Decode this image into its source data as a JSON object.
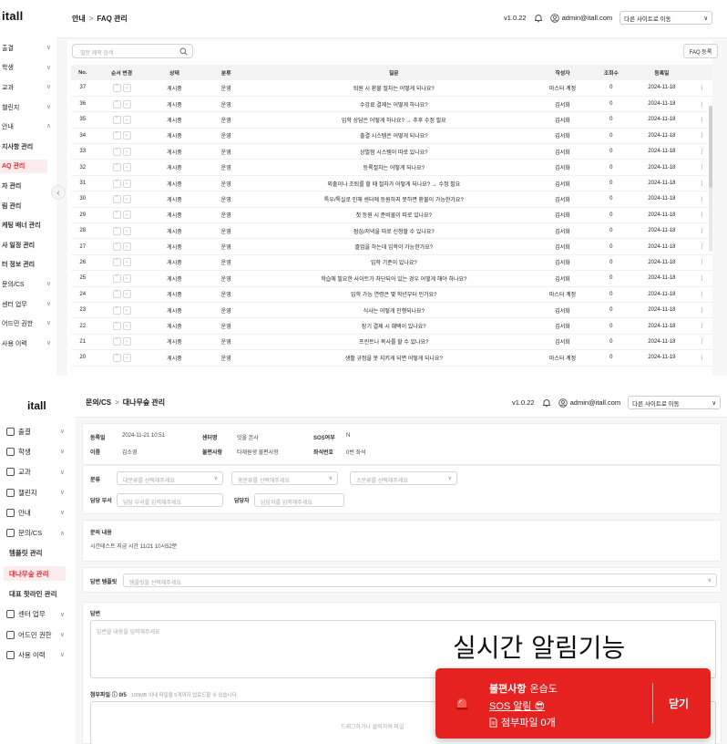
{
  "top": {
    "logo": "itall",
    "nav": [
      {
        "label": "출결",
        "kind": "group",
        "chev": "∨"
      },
      {
        "label": "학생",
        "kind": "group",
        "chev": "∨"
      },
      {
        "label": "교과",
        "kind": "group",
        "chev": "∨"
      },
      {
        "label": "챌린지",
        "kind": "group",
        "chev": "∨"
      },
      {
        "label": "안내",
        "kind": "group",
        "chev": "∧"
      },
      {
        "label": "지사항 관리",
        "kind": "sub"
      },
      {
        "label": "AQ 관리",
        "kind": "sub active"
      },
      {
        "label": "자 관리",
        "kind": "sub"
      },
      {
        "label": "림 관리",
        "kind": "sub"
      },
      {
        "label": "케팅 배너 관리",
        "kind": "sub"
      },
      {
        "label": "사 일정 관리",
        "kind": "sub"
      },
      {
        "label": "터 정보 관리",
        "kind": "sub"
      },
      {
        "label": "문의/CS",
        "kind": "group",
        "chev": "∨"
      },
      {
        "label": "센터 업무",
        "kind": "group",
        "chev": "∨"
      },
      {
        "label": "어드민 권한",
        "kind": "group",
        "chev": "∨"
      },
      {
        "label": "사용 이력",
        "kind": "group",
        "chev": "∨"
      }
    ],
    "breadcrumb": {
      "parent": "안내",
      "sep": ">",
      "current": "FAQ 관리"
    },
    "version": "v1.0.22",
    "admin_email": "admin@itall.com",
    "site_select": "다른 사이트로 이동",
    "search_placeholder": "질문 제목 검색",
    "register_button": "FAQ 등록",
    "columns": [
      "No.",
      "순서 변경",
      "상태",
      "분류",
      "질문",
      "작성자",
      "조회수",
      "등록일"
    ],
    "rows": [
      [
        "37",
        "게시중",
        "운영",
        "퇴원 시 환불 절차는 어떻게 되나요?",
        "마스터 계정",
        "0",
        "2024-11-18"
      ],
      [
        "36",
        "게시중",
        "운영",
        "수강료 결제는 어떻게 하나요?",
        "김서화",
        "0",
        "2024-11-18"
      ],
      [
        "35",
        "게시중",
        "운영",
        "입학 상담은 어떻게 하나요? → 추후 수정 필요",
        "김서화",
        "0",
        "2024-11-18"
      ],
      [
        "34",
        "게시중",
        "운영",
        "출결 시스템은 어떻게 되나요?",
        "김서화",
        "0",
        "2024-11-18"
      ],
      [
        "33",
        "게시중",
        "운영",
        "상벌점 시스템이 따로 있나요?",
        "김서화",
        "0",
        "2024-11-18"
      ],
      [
        "32",
        "게시중",
        "운영",
        "등록절차는 어떻게 되나요?",
        "김서화",
        "0",
        "2024-11-18"
      ],
      [
        "31",
        "게시중",
        "운영",
        "외출이나 조퇴를 할 때 절차가 어떻게 되나요? → 수정 필요",
        "김서화",
        "0",
        "2024-11-18"
      ],
      [
        "30",
        "게시중",
        "운영",
        "특우/특실로 인해 센터에 등원하지 못하면 환불이 가능한가요?",
        "김서화",
        "0",
        "2024-11-18"
      ],
      [
        "29",
        "게시중",
        "운영",
        "첫 등원 시 준비물이 따로 있나요?",
        "김서화",
        "0",
        "2024-11-18"
      ],
      [
        "28",
        "게시중",
        "운영",
        "점심/저녁을 따로 신청할 수 있나요?",
        "김서화",
        "0",
        "2024-11-18"
      ],
      [
        "27",
        "게시중",
        "운영",
        "졸업을 하는데 입학이 가능한가요?",
        "김서화",
        "0",
        "2024-11-18"
      ],
      [
        "26",
        "게시중",
        "운영",
        "입학 기준이 있나요?",
        "김서화",
        "0",
        "2024-11-18"
      ],
      [
        "25",
        "게시중",
        "운영",
        "학습에 필요한 사이트가 차단되어 있는 경우 어떻게 해야 하나요?",
        "김서화",
        "0",
        "2024-11-18"
      ],
      [
        "24",
        "게시중",
        "운영",
        "입학 가능 연령은 몇 학년부터 인가요?",
        "마스터 계정",
        "0",
        "2024-11-18"
      ],
      [
        "23",
        "게시중",
        "운영",
        "식사는 어떻게 진행되나요?",
        "김서화",
        "0",
        "2024-11-18"
      ],
      [
        "22",
        "게시중",
        "운영",
        "장기 결제 시 혜택이 있나요?",
        "김서화",
        "0",
        "2024-11-18"
      ],
      [
        "21",
        "게시중",
        "운영",
        "프린트나 복사를 할 수 있나요?",
        "김서화",
        "0",
        "2024-11-18"
      ],
      [
        "20",
        "게시중",
        "운영",
        "생활 규정을 못 지키게 되면 어떻게 되나요?",
        "마스터 계정",
        "0",
        "2024-11-19"
      ]
    ]
  },
  "bottom": {
    "logo": "itall",
    "nav": [
      {
        "label": "출결",
        "kind": "group",
        "chev": "∨"
      },
      {
        "label": "학생",
        "kind": "group",
        "chev": "∨"
      },
      {
        "label": "교과",
        "kind": "group",
        "chev": "∨"
      },
      {
        "label": "챌린지",
        "kind": "group",
        "chev": "∨"
      },
      {
        "label": "안내",
        "kind": "group",
        "chev": "∨"
      },
      {
        "label": "문의/CS",
        "kind": "group",
        "chev": "∧"
      },
      {
        "label": "템플릿 관리",
        "kind": "sub"
      },
      {
        "label": "대나무숲 관리",
        "kind": "sub active"
      },
      {
        "label": "대표 핫라인 관리",
        "kind": "sub"
      },
      {
        "label": "센터 업무",
        "kind": "group",
        "chev": "∨"
      },
      {
        "label": "어드민 권한",
        "kind": "group",
        "chev": "∨"
      },
      {
        "label": "사용 이력",
        "kind": "group",
        "chev": "∨"
      }
    ],
    "breadcrumb": {
      "parent": "문의/CS",
      "sep": ">",
      "current": "대나무숲 관리"
    },
    "version": "v1.0.22",
    "admin_email": "admin@itall.com",
    "site_select": "다른 사이트로 이동",
    "info": {
      "reg_label": "등록일",
      "reg_value": "2024-11-21 10:51",
      "center_label": "센터명",
      "center_value": "잇올 본사",
      "sos_label": "SOS여부",
      "sos_value": "N",
      "name_label": "이름",
      "name_value": "김소영",
      "complaint_label": "불편사항",
      "complaint_value": "타재원생 불편사항",
      "seat_label": "좌석번호",
      "seat_value": "0번 좌석"
    },
    "classify": {
      "label": "분류",
      "major": "대분류를 선택해주세요",
      "middle": "중분류를 선택해주세요",
      "minor": "소분류를 선택해주세요",
      "dept_label": "담당 부서",
      "dept_placeholder": "담당 부서를 입력해주세요",
      "person_label": "담당자",
      "person_placeholder": "담당자를 입력해주세요"
    },
    "inquiry": {
      "label": "문의 내용",
      "text": "시간테스트 지금 시간 11/21 10시52분"
    },
    "template": {
      "label": "답변 템플릿",
      "placeholder": "템플릿을 선택해주세요"
    },
    "answer": {
      "label": "답변",
      "placeholder": "답변을 내용을 입력해주세요"
    },
    "attach": {
      "label": "첨부파일",
      "count": "0/5",
      "hint": "100MB 이내 파일을 5개까지 업로드할 수 있습니다.",
      "drop": "드래그하거나 클릭하여 파일"
    }
  },
  "overlay": {
    "title": "실시간 알림기능",
    "toast_line1": "불편사항",
    "toast_line1_sub": "온습도",
    "toast_line2": "SOS 알림",
    "toast_line2_emoji": "😎",
    "toast_line3": "첨부파일 0개",
    "toast_close": "닫기",
    "toast_color": "#e62221",
    "accent": "#e3262f"
  }
}
